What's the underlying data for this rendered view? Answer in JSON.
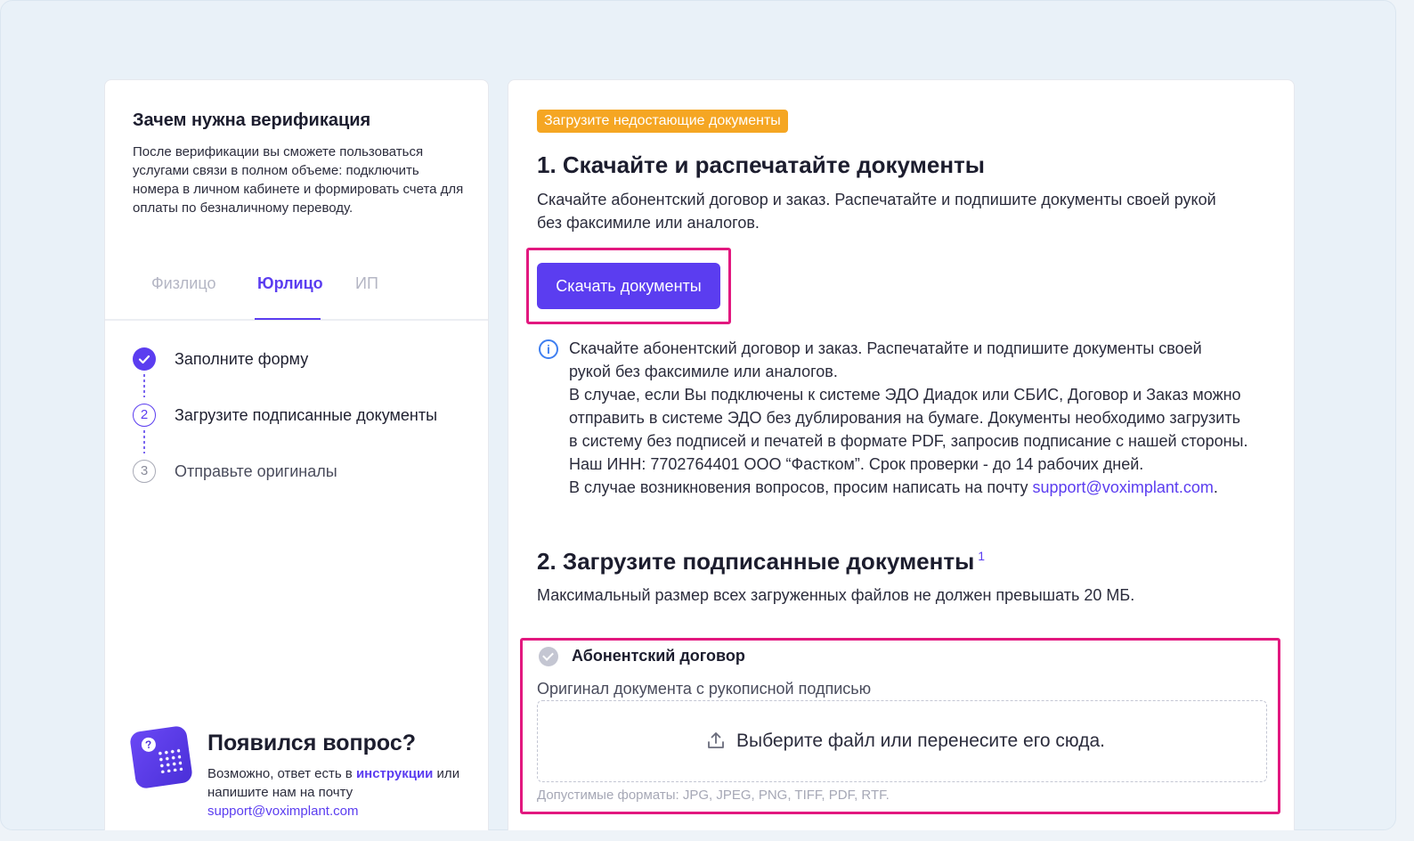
{
  "left": {
    "why_title": "Зачем нужна верификация",
    "why_text": "После верификации вы сможете пользоваться услугами связи в полном объеме: подключить номера в личном кабинете и формировать счета для оплаты по безналичному переводу.",
    "tabs": [
      {
        "label": "Физлицо",
        "active": false
      },
      {
        "label": "Юрлицо",
        "active": true
      },
      {
        "label": "ИП",
        "active": false
      }
    ],
    "steps": [
      {
        "num": "1",
        "label": "Заполните форму",
        "state": "done"
      },
      {
        "num": "2",
        "label": "Загрузите подписанные документы",
        "state": "current"
      },
      {
        "num": "3",
        "label": "Отправьте оригиналы",
        "state": "todo"
      }
    ],
    "help": {
      "title": "Появился вопрос?",
      "text_before": "Возможно, ответ есть в ",
      "link_instructions": "инструкции",
      "text_middle": " или напишите нам на почту ",
      "email": "support@voximplant.com"
    }
  },
  "right": {
    "badge": "Загрузите недостающие документы",
    "section1": {
      "title": "1. Скачайте и распечатайте документы",
      "text_line1": "Скачайте абонентский договор и заказ. Распечатайте и подпишите документы своей рукой",
      "text_line2": "без факсимиле или аналогов.",
      "button": "Скачать документы"
    },
    "info": {
      "lines": [
        "Скачайте абонентский договор и заказ. Распечатайте и подпишите документы своей",
        "рукой без факсимиле или аналогов.",
        "В случае, если Вы подключены к системе ЭДО Диадок или СБИС, Договор и Заказ можно",
        "отправить в системе ЭДО без дублирования на бумаге. Документы необходимо загрузить",
        "в систему без подписей и печатей в формате PDF, запросив подписание с нашей стороны.",
        "Наш ИНН: 7702764401 ООО “Фастком”. Срок проверки - до 14 рабочих дней."
      ],
      "last_line_text": "В случае возникновения вопросов, просим написать на почту ",
      "email": "support@voximplant.com",
      "period": "."
    },
    "section2": {
      "title": "2. Загрузите подписанные документы",
      "footnote": "1",
      "text": "Максимальный размер всех загруженных файлов не должен превышать 20 МБ."
    },
    "upload": {
      "doc_title": "Абонентский договор",
      "doc_sub": "Оригинал документа с рукописной подписью",
      "drop_text": "Выберите файл или перенесите его сюда.",
      "formats": "Допустимые форматы: JPG, JPEG, PNG, TIFF, PDF, RTF."
    }
  },
  "colors": {
    "accent": "#5b3df0",
    "warning": "#f5a623",
    "highlight": "#e2187f",
    "info": "#3f7ff0"
  },
  "icons": [
    "check-icon",
    "info-icon",
    "upload-icon",
    "help-question-icon"
  ]
}
